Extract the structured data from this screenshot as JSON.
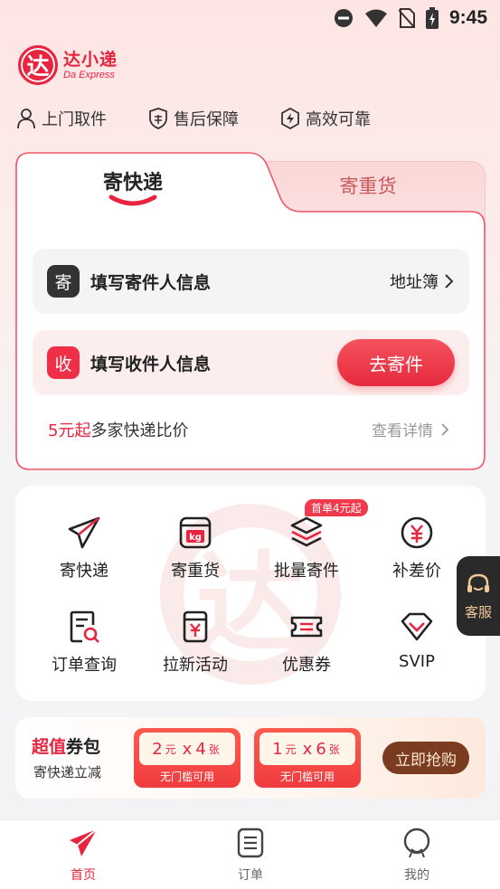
{
  "status_bar": {
    "time": "9:45"
  },
  "logo": {
    "mark": "达",
    "name_cn": "达小递",
    "name_en": "Da Express"
  },
  "features": [
    {
      "label": "上门取件",
      "icon": "person-icon"
    },
    {
      "label": "售后保障",
      "icon": "shield-icon"
    },
    {
      "label": "高效可靠",
      "icon": "lightning-icon"
    }
  ],
  "card": {
    "tab_active": "寄快递",
    "tab_inactive": "寄重货",
    "sender": {
      "badge": "寄",
      "title": "填写寄件人信息",
      "link": "地址簿"
    },
    "receiver": {
      "badge": "收",
      "title": "填写收件人信息",
      "button": "去寄件"
    },
    "compare_price": "5元起",
    "compare_text": "多家快递比价",
    "detail_link": "查看详情"
  },
  "services": {
    "watermark": "达",
    "items": [
      {
        "label": "寄快递",
        "icon": "paper-plane-icon"
      },
      {
        "label": "寄重货",
        "icon": "kg-weight-icon"
      },
      {
        "label": "批量寄件",
        "icon": "stack-icon"
      },
      {
        "label": "补差价",
        "icon": "yen-circle-icon"
      },
      {
        "label": "订单查询",
        "icon": "order-search-icon"
      },
      {
        "label": "拉新活动",
        "icon": "gift-jar-icon"
      },
      {
        "label": "优惠券",
        "icon": "coupon-icon"
      },
      {
        "label": "SVIP",
        "icon": "diamond-icon"
      }
    ],
    "tag": "首单4元起"
  },
  "float_service": {
    "label": "客服"
  },
  "coupon": {
    "title_red": "超值",
    "title_dark": "券包",
    "subtitle": "寄快递立减",
    "tickets": [
      {
        "amount": "2",
        "unit_yuan": "元",
        "times": "x",
        "count": "4",
        "unit_zhang": "张",
        "footer": "无门槛可用"
      },
      {
        "amount": "1",
        "unit_yuan": "元",
        "times": "x",
        "count": "6",
        "unit_zhang": "张",
        "footer": "无门槛可用"
      }
    ],
    "button": "立即抢购"
  },
  "bottom_nav": [
    {
      "label": "首页",
      "active": true
    },
    {
      "label": "订单",
      "active": false
    },
    {
      "label": "我的",
      "active": false
    }
  ],
  "colors": {
    "brand_red": "#e8243f",
    "coupon_button": "#7a3b21"
  }
}
